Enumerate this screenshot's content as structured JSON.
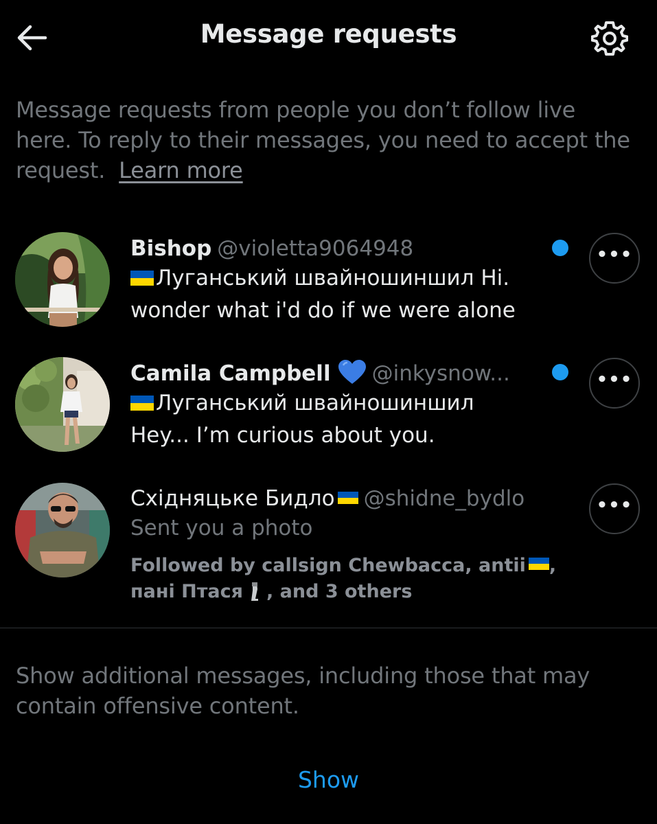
{
  "header": {
    "back_icon": "arrow-left-icon",
    "title": "Message requests",
    "settings_icon": "gear-icon"
  },
  "intro": {
    "text": "Message requests from people you don’t follow live here. To reply to their messages, you need to accept the request.",
    "learn_more": "Learn more"
  },
  "requests": [
    {
      "name": "Bishop",
      "handle": "@violetta9064948",
      "line1": "Луганський швайношиншил Hi.",
      "line2": "wonder what i'd do if we were alone",
      "unread": true
    },
    {
      "name": "Camila Campbell",
      "handle": "@inkysnow...",
      "line1": "Луганський швайношиншил",
      "line2": "Hey... I’m curious about you.",
      "unread": true
    },
    {
      "name": "Східняцьке Бидло",
      "handle": "@shidne_bydlo",
      "line1": "Sent you a photo",
      "followed_a": "Followed by callsign Chewbacca, antii",
      "followed_b": "пані Птася",
      "followed_c": ", and 3 others",
      "unread": false
    }
  ],
  "footer": {
    "additional_text": "Show additional messages, including those that may contain offensive content.",
    "show_label": "Show"
  },
  "colors": {
    "background": "#000000",
    "accent": "#1d9bf0",
    "muted_text": "#71767b",
    "primary_text": "#e7e9ea",
    "flag_blue": "#0057b7",
    "flag_yellow": "#ffd700"
  }
}
